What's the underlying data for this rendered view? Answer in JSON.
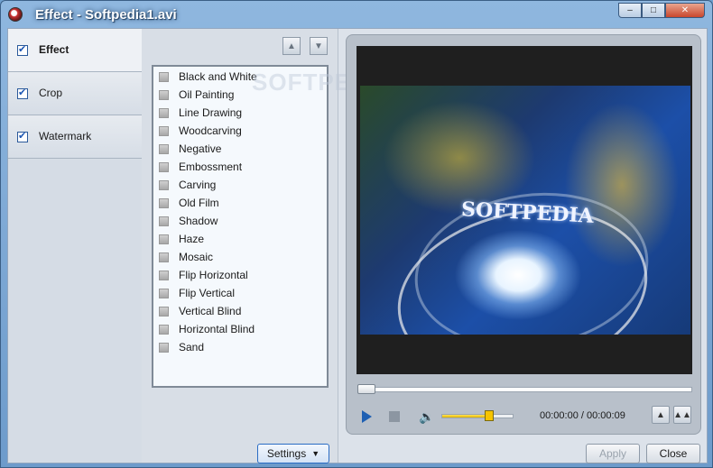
{
  "window": {
    "title": "Effect - Softpedia1.avi",
    "controls": {
      "minimize": "–",
      "maximize": "□",
      "close": "✕"
    }
  },
  "tabs": [
    {
      "label": "Effect",
      "checked": true,
      "active": true
    },
    {
      "label": "Crop",
      "checked": true,
      "active": false
    },
    {
      "label": "Watermark",
      "checked": true,
      "active": false
    }
  ],
  "effects": {
    "move_up": "▲",
    "move_down": "▼",
    "items": [
      "Black and White",
      "Oil Painting",
      "Line Drawing",
      "Woodcarving",
      "Negative",
      "Embossment",
      "Carving",
      "Old Film",
      "Shadow",
      "Haze",
      "Mosaic",
      "Flip Horizontal",
      "Flip Vertical",
      "Vertical Blind",
      "Horizontal Blind",
      "Sand"
    ],
    "settings_label": "Settings",
    "settings_arrow": "▼",
    "list_watermark": "SOFTPEDIA"
  },
  "preview": {
    "frame_text": "SOFTPEDIA",
    "seek_progress": 0,
    "volume_level": 0.68,
    "timecode": "00:00:00 / 00:00:09",
    "volume_icon": "🔉",
    "snapshot_single": "▲",
    "snapshot_multi": "▲▲"
  },
  "buttons": {
    "apply": "Apply",
    "close": "Close"
  }
}
